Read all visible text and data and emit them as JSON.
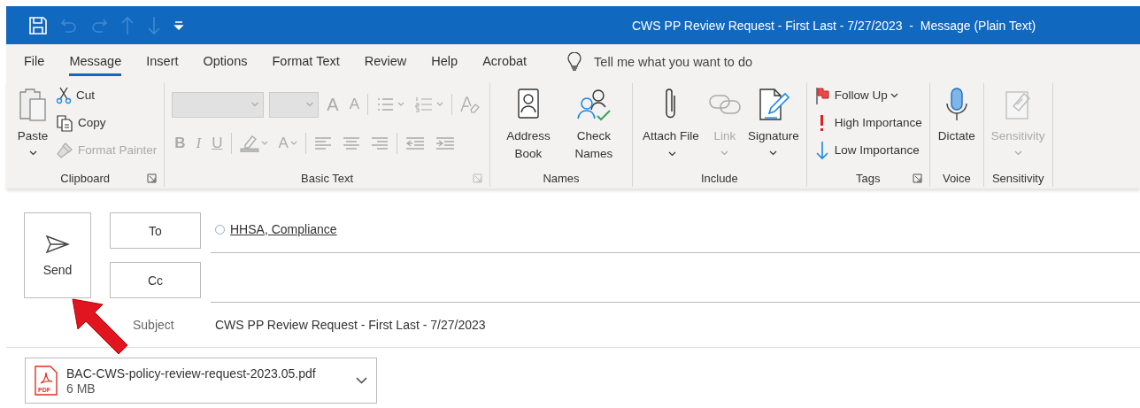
{
  "window": {
    "title": "CWS PP Review Request - First Last - 7/27/2023  -  Message (Plain Text)"
  },
  "quick_access": [
    {
      "disabled": false
    },
    {
      "disabled": true
    },
    {
      "disabled": true
    },
    {
      "disabled": true
    },
    {
      "disabled": true
    },
    {
      "disabled": false
    }
  ],
  "tabs": [
    {
      "label": "File",
      "selected": false
    },
    {
      "label": "Message",
      "selected": true
    },
    {
      "label": "Insert",
      "selected": false
    },
    {
      "label": "Options",
      "selected": false
    },
    {
      "label": "Format Text",
      "selected": false
    },
    {
      "label": "Review",
      "selected": false
    },
    {
      "label": "Help",
      "selected": false
    },
    {
      "label": "Acrobat",
      "selected": false
    }
  ],
  "tell_me": {
    "placeholder": "Tell me what you want to do"
  },
  "ribbon_groups": [
    {
      "name": "Clipboard",
      "launcher": true,
      "large": [
        {
          "label": "Paste",
          "disabled": false,
          "dropdown": true
        }
      ],
      "small": [
        {
          "label": "Cut",
          "disabled": false
        },
        {
          "label": "Copy",
          "disabled": false
        },
        {
          "label": "Format Painter",
          "disabled": true
        }
      ]
    },
    {
      "name": "Basic Text",
      "launcher": true,
      "disabled": true,
      "rows": [
        [
          {
            "kind": "combo"
          },
          {
            "kind": "combo-small"
          },
          {
            "kind": "letter",
            "label": "A"
          },
          {
            "kind": "letter",
            "label": "A"
          },
          {
            "kind": "sep"
          },
          {
            "kind": "icon",
            "dropdown": true
          },
          {
            "kind": "icon",
            "dropdown": true
          },
          {
            "kind": "sep"
          },
          {
            "kind": "icon"
          }
        ],
        [
          {
            "kind": "letter",
            "label": "B"
          },
          {
            "kind": "letter",
            "label": "I"
          },
          {
            "kind": "letter",
            "label": "U"
          },
          {
            "kind": "sep"
          },
          {
            "kind": "icon",
            "dropdown": true
          },
          {
            "kind": "letter",
            "label": "A",
            "dropdown": true
          },
          {
            "kind": "sep"
          },
          {
            "kind": "icon"
          },
          {
            "kind": "icon"
          },
          {
            "kind": "icon"
          },
          {
            "kind": "sep"
          },
          {
            "kind": "icon"
          },
          {
            "kind": "icon"
          }
        ]
      ]
    },
    {
      "name": "Names",
      "launcher": false,
      "large": [
        {
          "label": "Address Book",
          "disabled": false
        },
        {
          "label": "Check Names",
          "disabled": false
        }
      ]
    },
    {
      "name": "Include",
      "launcher": false,
      "large": [
        {
          "label": "Attach File",
          "disabled": false,
          "dropdown": true
        },
        {
          "label": "Link",
          "disabled": true,
          "dropdown": true
        },
        {
          "label": "Signature",
          "disabled": false,
          "dropdown": true
        }
      ]
    },
    {
      "name": "Tags",
      "launcher": true,
      "small": [
        {
          "label": "Follow Up",
          "disabled": false,
          "dropdown": true
        },
        {
          "label": "High Importance",
          "disabled": false
        },
        {
          "label": "Low Importance",
          "disabled": false
        }
      ]
    },
    {
      "name": "Voice",
      "launcher": false,
      "large": [
        {
          "label": "Dictate",
          "disabled": false
        }
      ]
    },
    {
      "name": "Sensitivity",
      "launcher": false,
      "large": [
        {
          "label": "Sensitivity",
          "disabled": true,
          "dropdown": true
        }
      ]
    }
  ],
  "compose": {
    "send": {
      "label": "Send"
    },
    "to": {
      "label": "To",
      "recipients": [
        {
          "name": "HHSA, Compliance"
        }
      ]
    },
    "cc": {
      "label": "Cc"
    },
    "subject": {
      "label": "Subject",
      "value": "CWS PP Review Request - First Last - 7/27/2023"
    },
    "attachments": [
      {
        "name": "BAC-CWS-policy-review-request-2023.05.pdf",
        "size": "6 MB",
        "type": "PDF"
      }
    ]
  }
}
